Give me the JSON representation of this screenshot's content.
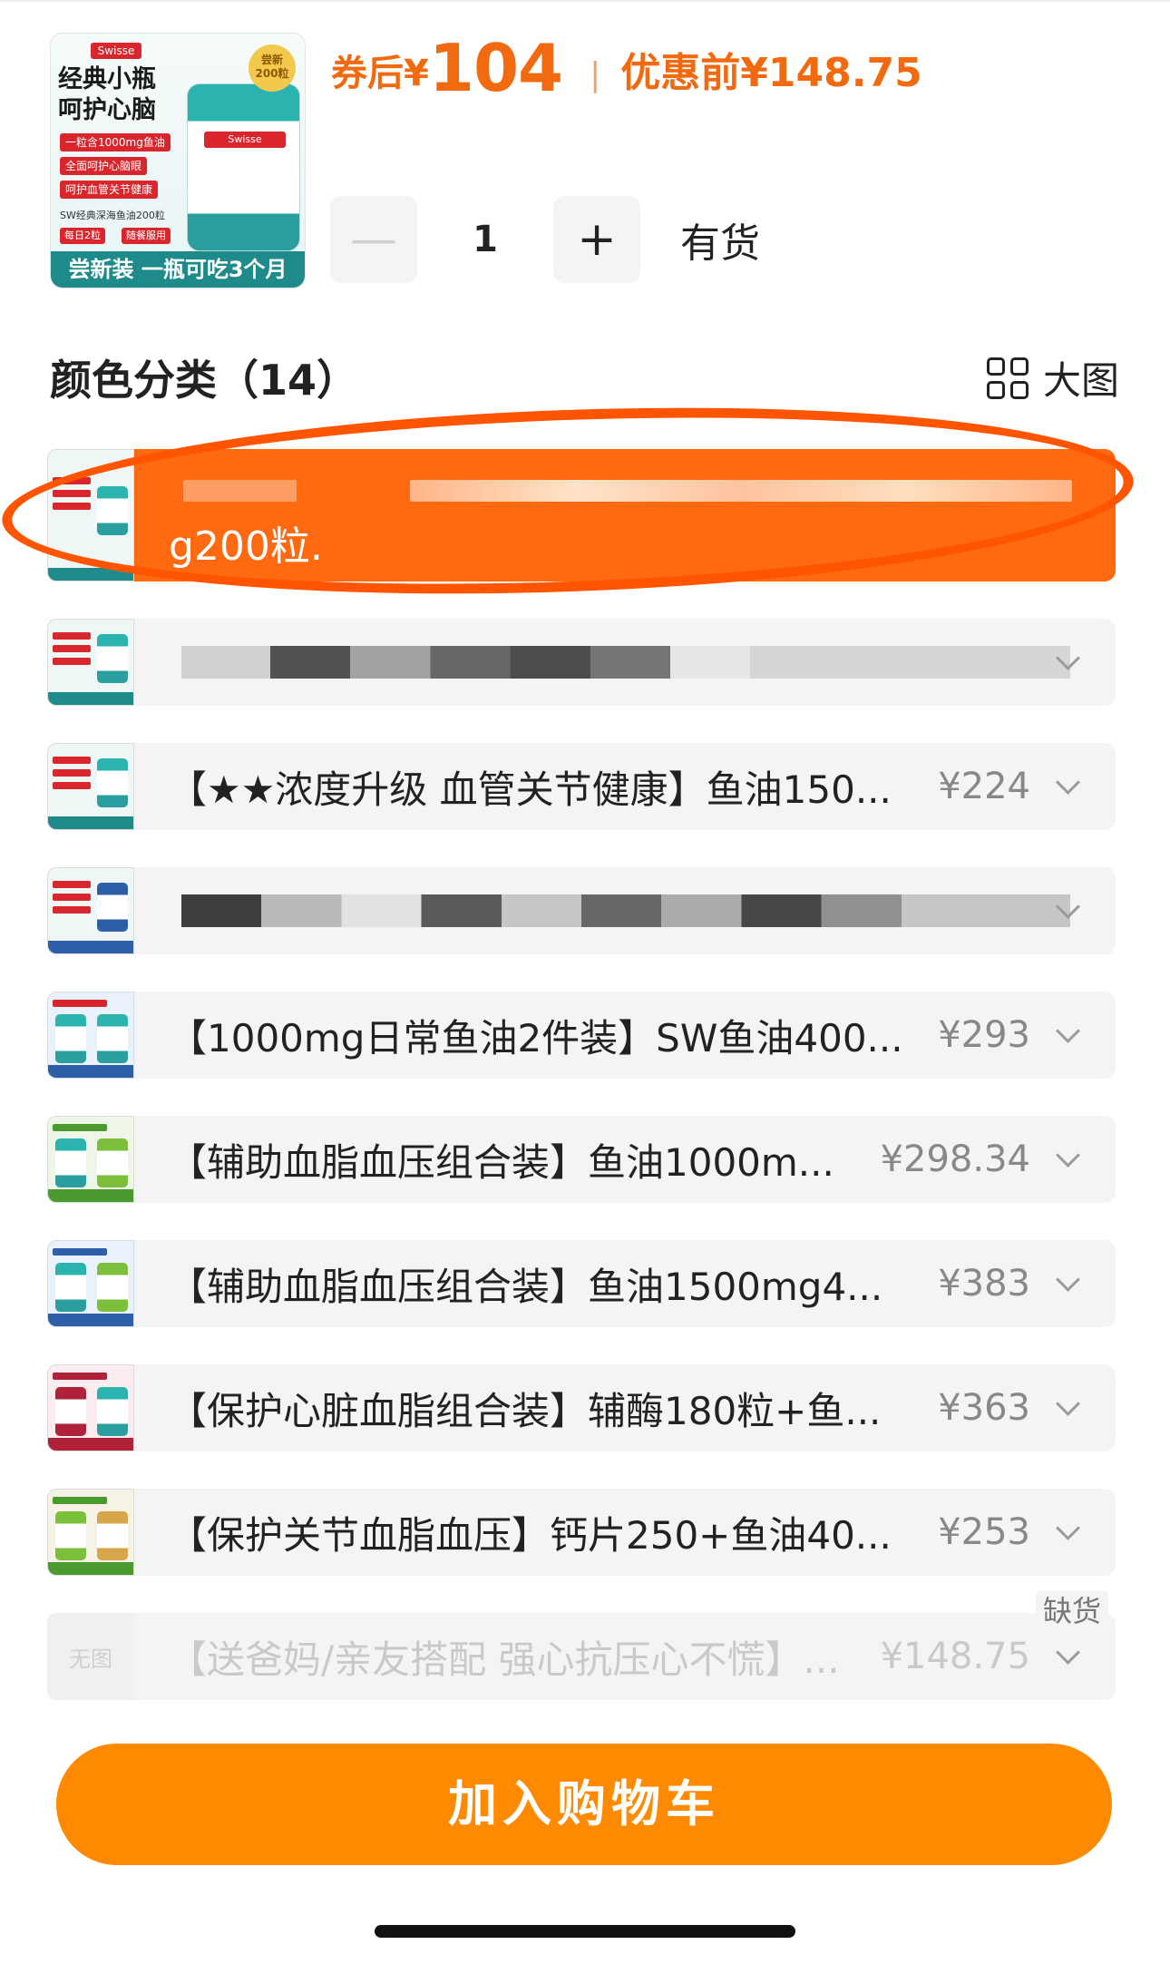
{
  "header": {
    "thumb": {
      "brand": "Swisse",
      "title_line1": "经典小瓶",
      "title_line2": "呵护心脑",
      "tags": [
        "一粒含1000mg鱼油",
        "全面呵护心脑眼",
        "呵护血管关节健康"
      ],
      "small": "SW经典深海鱼油200粒",
      "tags2": [
        "每日2粒",
        "随餐服用"
      ],
      "seal": "尝新 200粒",
      "jar_label": "Swisse",
      "bottom": "尝新装 一瓶可吃3个月"
    },
    "price": {
      "after_label": "券后",
      "currency": "¥",
      "after_value": "104",
      "separator": "|",
      "before_label": "优惠前",
      "before_value": "¥148.75"
    },
    "quantity": {
      "minus": "—",
      "value": "1",
      "plus": "+"
    },
    "stock": "有货"
  },
  "section": {
    "title": "颜色分类（14）",
    "big_view": "大图",
    "big_view_icon": "grid-icon"
  },
  "variants": [
    {
      "label": "g200粒.",
      "price": "",
      "state": "selected"
    },
    {
      "label": "",
      "price": "",
      "state": "redacted"
    },
    {
      "label": "【★★浓度升级 血管关节健康】鱼油150...",
      "price": "¥224",
      "state": "normal"
    },
    {
      "label": "",
      "price": "",
      "state": "redacted"
    },
    {
      "label": "【1000mg日常鱼油2件装】SW鱼油400...",
      "price": "¥293",
      "state": "normal"
    },
    {
      "label": "【辅助血脂血压组合装】鱼油1000m...",
      "price": "¥298.34",
      "state": "normal"
    },
    {
      "label": "【辅助血脂血压组合装】鱼油1500mg4...",
      "price": "¥383",
      "state": "normal"
    },
    {
      "label": "【保护心脏血脂组合装】辅酶180粒+鱼...",
      "price": "¥363",
      "state": "normal"
    },
    {
      "label": "【保护关节血脂血压】钙片250+鱼油40...",
      "price": "¥253",
      "state": "normal"
    },
    {
      "label": "【送爸妈/亲友搭配 强心抗压心不慌】...",
      "price": "¥148.75",
      "state": "disabled",
      "no_image": "无图",
      "badge": "缺货"
    }
  ],
  "cart_button": "加入购物车",
  "colors": {
    "accent": "#ff6a10",
    "price": "#f26a10",
    "button": "#ff8a00"
  }
}
